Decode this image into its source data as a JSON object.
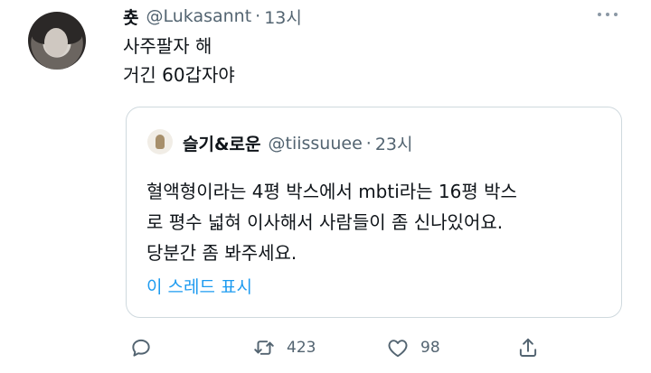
{
  "tweet": {
    "display_name": "춋",
    "handle": "@Lukasannt",
    "separator": "·",
    "time": "13시",
    "text_lines": [
      "사주팔자 해",
      "거긴 60갑자야"
    ]
  },
  "quote": {
    "display_name": "슬기&로운",
    "handle": "@tiissuuee",
    "separator": "·",
    "time": "23시",
    "text_lines": [
      "혈액형이라는 4평 박스에서 mbti라는 16평 박스",
      "로 평수 넓혀 이사해서 사람들이 좀 신나있어요.",
      "당분간 좀 봐주세요."
    ],
    "show_thread_label": "이 스레드 표시"
  },
  "actions": {
    "reply_icon": "reply-icon",
    "retweet_icon": "retweet-icon",
    "retweet_count": "423",
    "like_icon": "like-icon",
    "like_count": "98",
    "share_icon": "share-icon"
  },
  "colors": {
    "accent": "#1d9bf0",
    "secondary_text": "#536471",
    "border": "#cfd9de"
  }
}
